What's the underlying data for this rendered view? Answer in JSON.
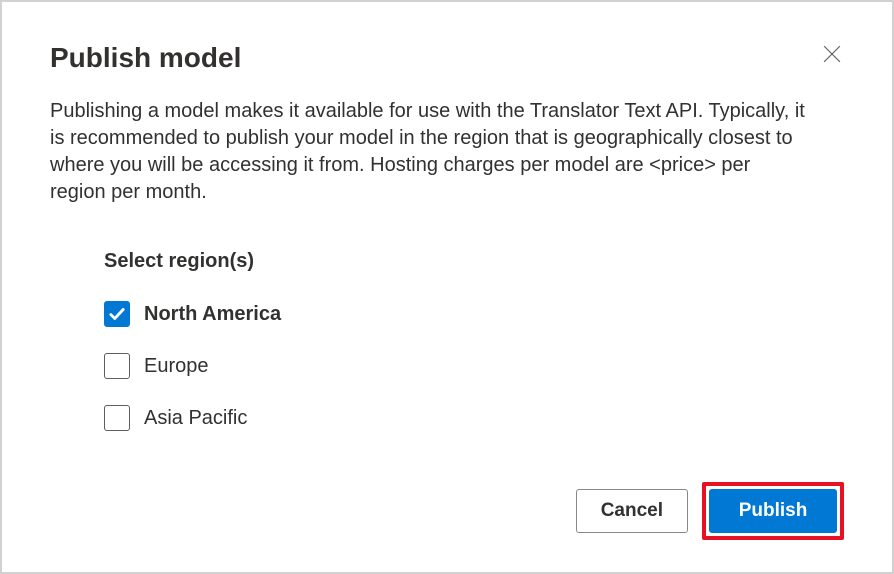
{
  "dialog": {
    "title": "Publish model",
    "description": "Publishing a model makes it available for use with the Translator Text API. Typically, it is recommended to publish your model in the region that is geographically closest to where you will be accessing it from. Hosting charges per model are <price> per region per month.",
    "regionLabel": "Select region(s)",
    "regions": [
      {
        "name": "North America",
        "checked": true
      },
      {
        "name": "Europe",
        "checked": false
      },
      {
        "name": "Asia Pacific",
        "checked": false
      }
    ],
    "buttons": {
      "cancel": "Cancel",
      "publish": "Publish"
    }
  }
}
